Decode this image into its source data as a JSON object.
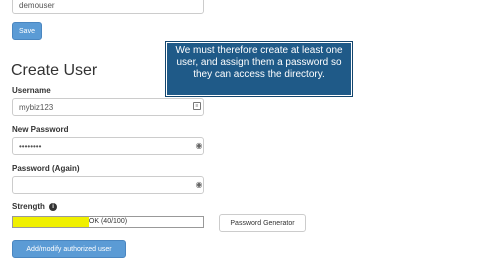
{
  "top_form": {
    "username_value": "demouser",
    "save_label": "Save"
  },
  "create_user": {
    "heading": "Create User",
    "username_label": "Username",
    "username_value": "mybiz123",
    "new_password_label": "New Password",
    "new_password_value": "••••••••",
    "password_again_label": "Password (Again)",
    "password_again_value": "",
    "strength_label": "Strength",
    "strength_info_icon": "info-icon",
    "strength_text": "OK (40/100)",
    "strength_score": 40,
    "strength_max": 100,
    "password_generator_label": "Password Generator",
    "submit_label": "Add/modify authorized user"
  },
  "callout": {
    "text": "We must therefore create at least one user, and assign them a password so they can access the directory."
  },
  "colors": {
    "primary_button": "#5b9bd5",
    "callout_bg": "#1f5a88",
    "strength_fill": "#f0f000"
  }
}
